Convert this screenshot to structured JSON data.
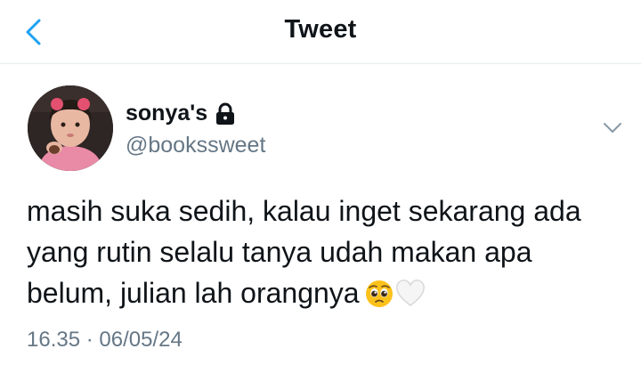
{
  "header": {
    "title": "Tweet",
    "back_icon": "chevron-left-icon",
    "accent_color": "#1da1f2"
  },
  "tweet": {
    "author": {
      "display_name": "sonya's",
      "handle": "@bookssweet",
      "protected_icon": "lock-icon"
    },
    "text": "masih suka sedih, kalau inget sekarang ada yang rutin selalu tanya udah makan apa belum, julian lah orangnya",
    "emojis": [
      "pleading-face-emoji",
      "white-heart-emoji"
    ],
    "menu_icon": "chevron-down-icon",
    "time": "16.35",
    "separator": "·",
    "date": "06/05/24"
  },
  "colors": {
    "text": "#0f1419",
    "secondary": "#657786",
    "divider": "#e6ecf0"
  }
}
